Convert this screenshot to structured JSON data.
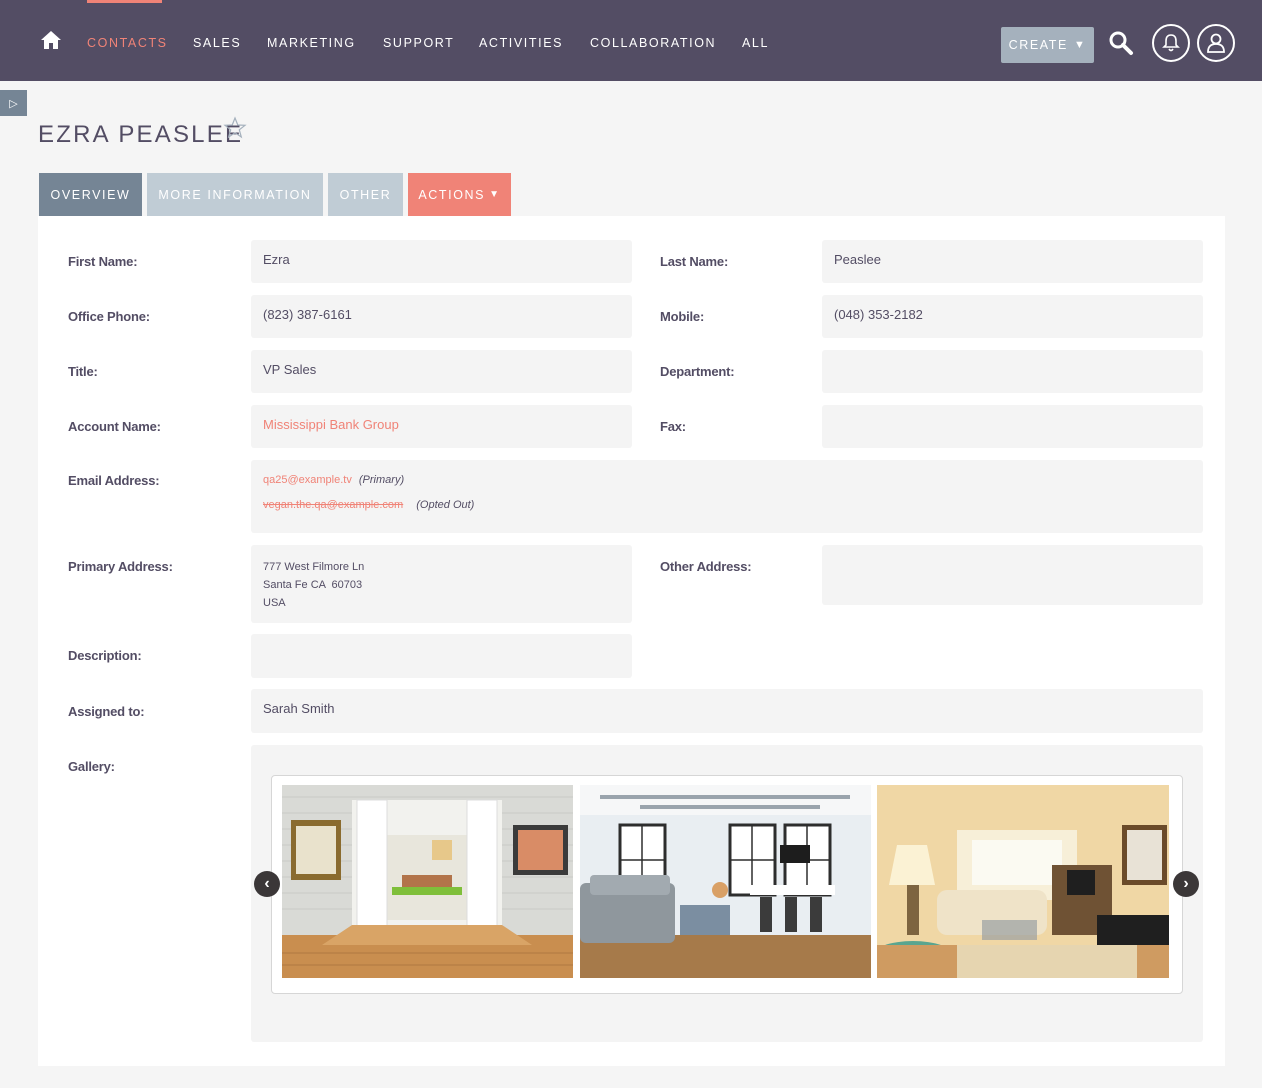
{
  "nav": {
    "items": [
      "CONTACTS",
      "SALES",
      "MARKETING",
      "SUPPORT",
      "ACTIVITIES",
      "COLLABORATION",
      "ALL"
    ],
    "create_label": "CREATE",
    "accent": "#f08377",
    "background": "#534d64"
  },
  "record": {
    "title": "EZRA PEASLEE"
  },
  "tabs": {
    "overview": "OVERVIEW",
    "more": "MORE INFORMATION",
    "other": "OTHER",
    "actions": "ACTIONS"
  },
  "fields": {
    "first_name": {
      "label": "First Name:",
      "value": "Ezra"
    },
    "last_name": {
      "label": "Last Name:",
      "value": "Peaslee"
    },
    "office_phone": {
      "label": "Office Phone:",
      "value": "(823) 387-6161"
    },
    "mobile": {
      "label": "Mobile:",
      "value": "(048) 353-2182"
    },
    "title": {
      "label": "Title:",
      "value": "VP Sales"
    },
    "department": {
      "label": "Department:",
      "value": ""
    },
    "account_name": {
      "label": "Account Name:",
      "value": "Mississippi Bank Group"
    },
    "fax": {
      "label": "Fax:",
      "value": ""
    },
    "email": {
      "label": "Email Address:",
      "primary": "qa25@example.tv",
      "primary_tag": "(Primary)",
      "opted_out": "vegan.the.qa@example.com",
      "opted_out_tag": "(Opted Out)"
    },
    "primary_address": {
      "label": "Primary Address:",
      "line1": "777 West Filmore Ln",
      "line2": "Santa Fe CA  60703",
      "line3": "USA"
    },
    "other_address": {
      "label": "Other Address:",
      "value": ""
    },
    "description": {
      "label": "Description:",
      "value": ""
    },
    "assigned_to": {
      "label": "Assigned to:",
      "value": "Sarah Smith"
    },
    "gallery": {
      "label": "Gallery:"
    }
  },
  "gallery": {
    "prev": "‹",
    "next": "›",
    "photos": [
      "living-room-doors-photo",
      "loft-office-photo",
      "sitting-room-photo"
    ]
  }
}
